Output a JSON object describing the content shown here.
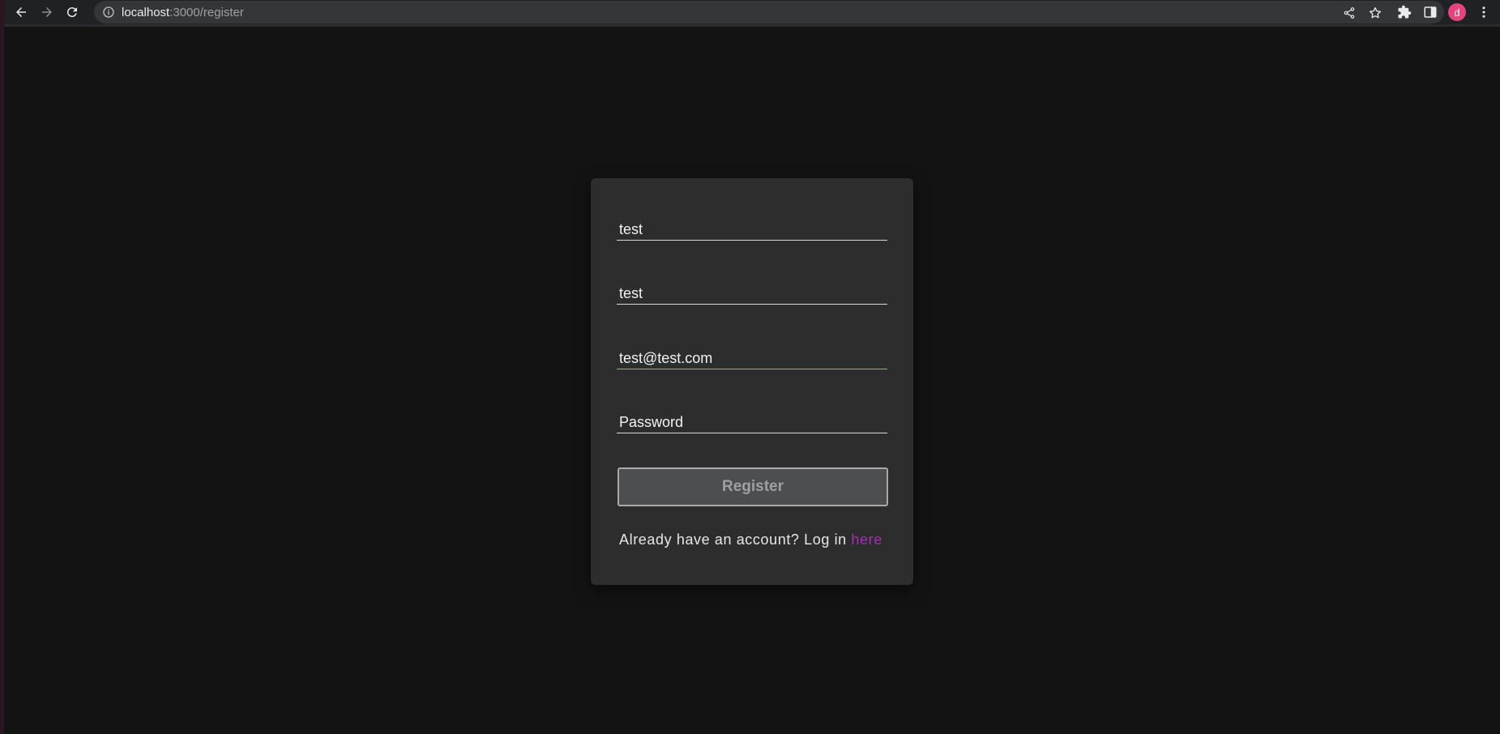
{
  "browser": {
    "url_host": "localhost",
    "url_path": ":3000/register",
    "avatar_letter": "d",
    "avatar_color": "#e8437d",
    "icons": [
      "back-arrow-icon",
      "forward-arrow-icon",
      "reload-icon",
      "site-info-icon",
      "share-icon",
      "bookmark-star-icon",
      "extensions-puzzle-icon",
      "side-panel-icon",
      "more-menu-icon"
    ]
  },
  "form": {
    "first_field": {
      "value": "test",
      "placeholder": ""
    },
    "second_field": {
      "value": "test",
      "placeholder": ""
    },
    "email_field": {
      "value": "test@test.com",
      "placeholder": ""
    },
    "password_field": {
      "value": "",
      "placeholder": "Password"
    },
    "submit_label": "Register",
    "login_prompt": "Already have an account? Log in ",
    "login_link": "here"
  },
  "colors": {
    "page_background": "#131313",
    "card_background": "#2d2d2d",
    "focus_underline": "#5fd35f",
    "link": "#a72bb8"
  }
}
